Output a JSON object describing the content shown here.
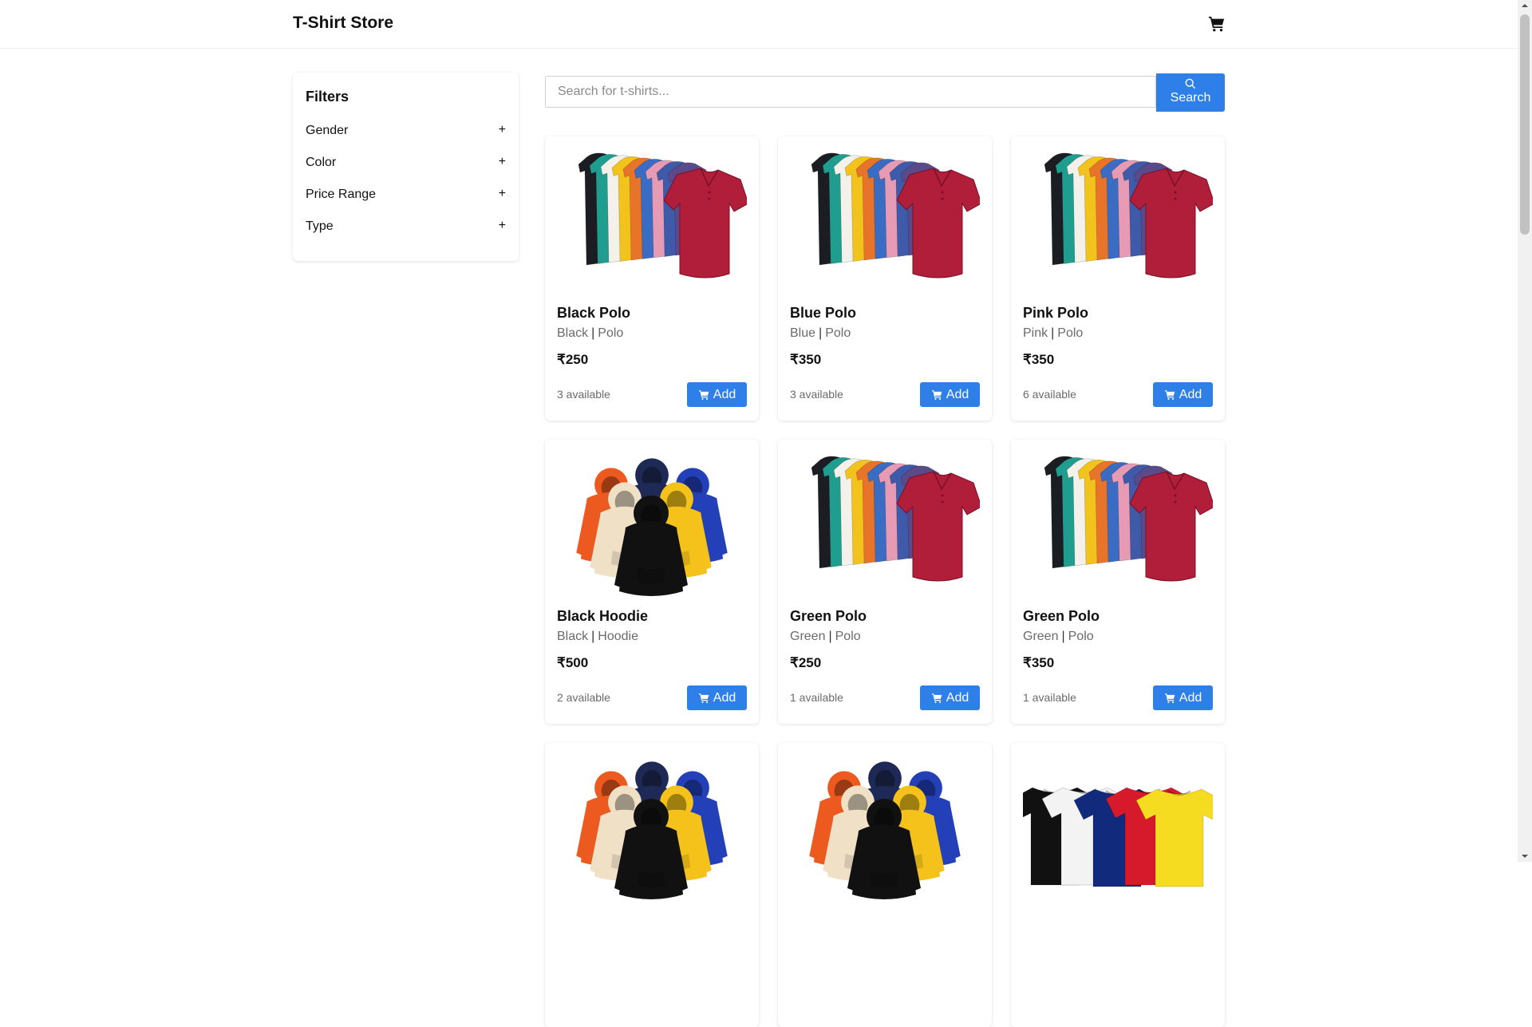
{
  "header": {
    "brand": "T-Shirt Store",
    "cart_icon": "cart-icon"
  },
  "filters": {
    "title": "Filters",
    "items": [
      {
        "label": "Gender",
        "toggle": "+"
      },
      {
        "label": "Color",
        "toggle": "+"
      },
      {
        "label": "Price Range",
        "toggle": "+"
      },
      {
        "label": "Type",
        "toggle": "+"
      }
    ]
  },
  "search": {
    "placeholder": "Search for t-shirts...",
    "button_label": "Search",
    "icon": "search-icon"
  },
  "products": [
    {
      "name": "Black Polo",
      "color": "Black",
      "type": "Polo",
      "price": "₹250",
      "stock": "3 available",
      "add_label": "Add",
      "image": "polo-stack"
    },
    {
      "name": "Blue Polo",
      "color": "Blue",
      "type": "Polo",
      "price": "₹350",
      "stock": "3 available",
      "add_label": "Add",
      "image": "polo-stack"
    },
    {
      "name": "Pink Polo",
      "color": "Pink",
      "type": "Polo",
      "price": "₹350",
      "stock": "6 available",
      "add_label": "Add",
      "image": "polo-stack"
    },
    {
      "name": "Black Hoodie",
      "color": "Black",
      "type": "Hoodie",
      "price": "₹500",
      "stock": "2 available",
      "add_label": "Add",
      "image": "hoodie-group"
    },
    {
      "name": "Green Polo",
      "color": "Green",
      "type": "Polo",
      "price": "₹250",
      "stock": "1 available",
      "add_label": "Add",
      "image": "polo-stack"
    },
    {
      "name": "Green Polo",
      "color": "Green",
      "type": "Polo",
      "price": "₹350",
      "stock": "1 available",
      "add_label": "Add",
      "image": "polo-stack"
    },
    {
      "image": "hoodie-group"
    },
    {
      "image": "hoodie-group"
    },
    {
      "image": "tshirt-row"
    }
  ],
  "colors": {
    "accent": "#2f7fe8",
    "text": "#111111",
    "muted": "#6b6b6b"
  }
}
